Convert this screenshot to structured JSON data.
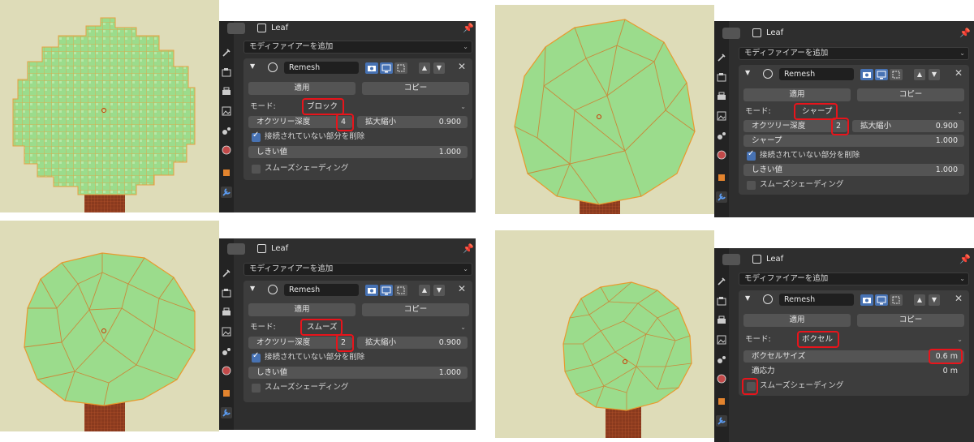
{
  "panels": [
    {
      "object_name": "Leaf",
      "add_modifier": "モディファイアーを追加",
      "modifier_name": "Remesh",
      "apply_label": "適用",
      "copy_label": "コピー",
      "mode_label": "モード:",
      "mode_value": "ブロック",
      "octree_label": "オクツリー深度",
      "octree_value": "4",
      "scale_label": "拡大縮小",
      "scale_value": "0.900",
      "remove_disconnected_label": "接続されていない部分を削除",
      "threshold_label": "しきい値",
      "threshold_value": "1.000",
      "smooth_shading_label": "スムーズシェーディング"
    },
    {
      "object_name": "Leaf",
      "add_modifier": "モディファイアーを追加",
      "modifier_name": "Remesh",
      "apply_label": "適用",
      "copy_label": "コピー",
      "mode_label": "モード:",
      "mode_value": "シャープ",
      "octree_label": "オクツリー深度",
      "octree_value": "2",
      "scale_label": "拡大縮小",
      "scale_value": "0.900",
      "sharpness_label": "シャープ",
      "sharpness_value": "1.000",
      "remove_disconnected_label": "接続されていない部分を削除",
      "threshold_label": "しきい値",
      "threshold_value": "1.000",
      "smooth_shading_label": "スムーズシェーディング"
    },
    {
      "object_name": "Leaf",
      "add_modifier": "モディファイアーを追加",
      "modifier_name": "Remesh",
      "apply_label": "適用",
      "copy_label": "コピー",
      "mode_label": "モード:",
      "mode_value": "スムーズ",
      "octree_label": "オクツリー深度",
      "octree_value": "2",
      "scale_label": "拡大縮小",
      "scale_value": "0.900",
      "remove_disconnected_label": "接続されていない部分を削除",
      "threshold_label": "しきい値",
      "threshold_value": "1.000",
      "smooth_shading_label": "スムーズシェーディング"
    },
    {
      "object_name": "Leaf",
      "add_modifier": "モディファイアーを追加",
      "modifier_name": "Remesh",
      "apply_label": "適用",
      "copy_label": "コピー",
      "mode_label": "モード:",
      "mode_value": "ボクセル",
      "voxel_size_label": "ボクセルサイズ",
      "voxel_size_value": "0.6 m",
      "adaptivity_label": "適応力",
      "adaptivity_value": "0 m",
      "smooth_shading_label": "スムーズシェーディング"
    }
  ],
  "colors": {
    "highlight": "#e8141b",
    "mesh_fill": "#9bdc8c",
    "mesh_edge": "#e89a2e",
    "trunk": "#8a3a1e",
    "viewport_bg": "#dedcb8",
    "toggle_blue": "#4772b3"
  }
}
